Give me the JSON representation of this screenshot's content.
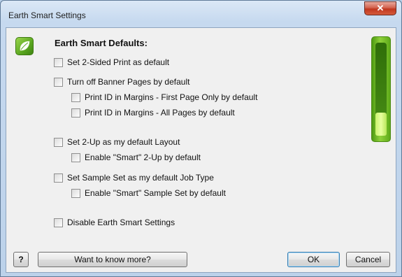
{
  "window": {
    "title": "Earth Smart Settings",
    "close_glyph": "✕"
  },
  "heading": "Earth Smart Defaults:",
  "options": {
    "two_sided": {
      "label": "Set 2-Sided Print as default",
      "checked": false
    },
    "banner": {
      "label": "Turn off Banner Pages by default",
      "checked": false
    },
    "id_first": {
      "label": "Print ID in Margins - First Page Only by default",
      "checked": false
    },
    "id_all": {
      "label": "Print ID in Margins - All Pages by default",
      "checked": false
    },
    "two_up": {
      "label": "Set 2-Up as my default Layout",
      "checked": false
    },
    "smart_two_up": {
      "label": "Enable \"Smart\" 2-Up by default",
      "checked": false
    },
    "sample_set": {
      "label": "Set Sample Set as my default Job Type",
      "checked": false
    },
    "smart_sample": {
      "label": "Enable \"Smart\" Sample Set by default",
      "checked": false
    },
    "disable": {
      "label": "Disable Earth Smart Settings",
      "checked": false
    }
  },
  "meter": {
    "level": 0.25,
    "icon": "earth-smart-meter"
  },
  "buttons": {
    "help": "?",
    "learn_more": "Want to know more?",
    "ok": "OK",
    "cancel": "Cancel"
  },
  "colors": {
    "accent_green": "#5aa620",
    "close_red": "#c1371f"
  }
}
